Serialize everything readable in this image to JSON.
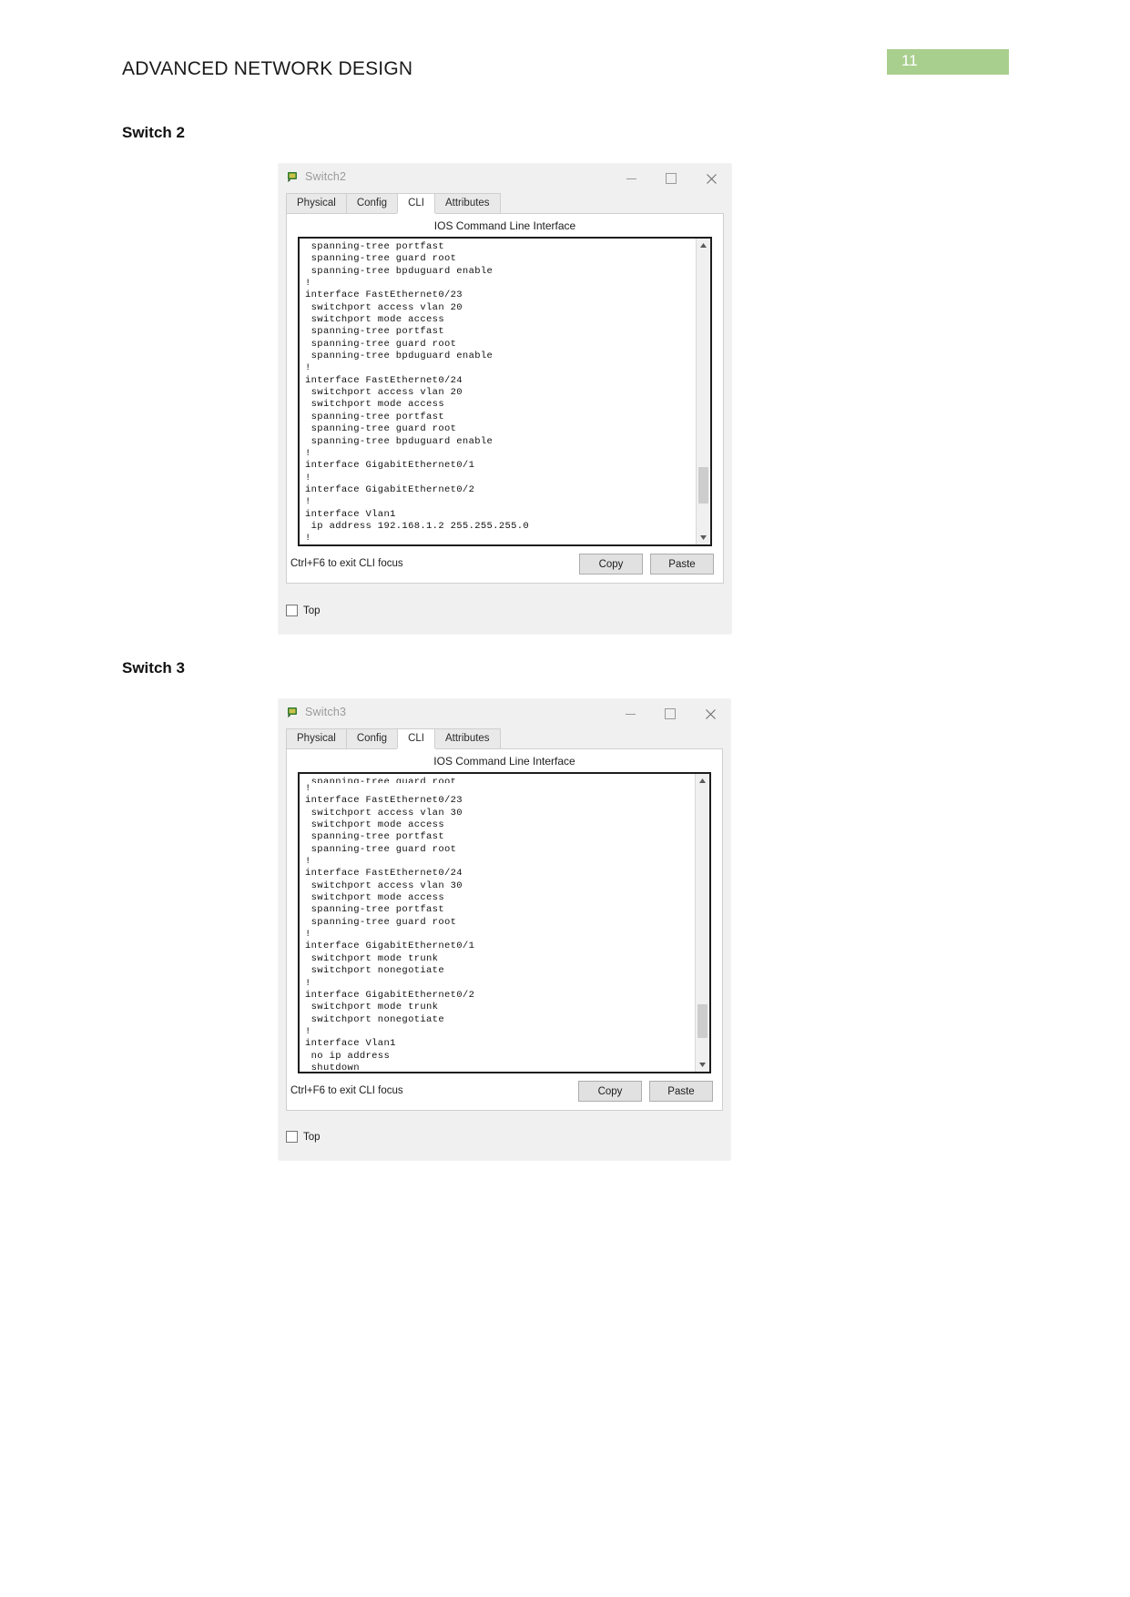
{
  "document": {
    "header_title": "ADVANCED NETWORK DESIGN",
    "page_number": "11",
    "page_number_bg": "#a9cf8f"
  },
  "sections": [
    {
      "caption": "Switch 2"
    },
    {
      "caption": "Switch 3"
    }
  ],
  "windows": [
    {
      "title": "Switch2",
      "icon": "packet-tracer-device-icon",
      "controls": {
        "minimize": "minimize-icon",
        "maximize": "maximize-icon",
        "close": "close-icon"
      },
      "tabs": [
        {
          "label": "Physical",
          "active": false
        },
        {
          "label": "Config",
          "active": false
        },
        {
          "label": "CLI",
          "active": true
        },
        {
          "label": "Attributes",
          "active": false
        }
      ],
      "cli_heading": "IOS Command Line Interface",
      "cli_lines": [
        " spanning-tree portfast",
        " spanning-tree guard root",
        " spanning-tree bpduguard enable",
        "!",
        "interface FastEthernet0/23",
        " switchport access vlan 20",
        " switchport mode access",
        " spanning-tree portfast",
        " spanning-tree guard root",
        " spanning-tree bpduguard enable",
        "!",
        "interface FastEthernet0/24",
        " switchport access vlan 20",
        " switchport mode access",
        " spanning-tree portfast",
        " spanning-tree guard root",
        " spanning-tree bpduguard enable",
        "!",
        "interface GigabitEthernet0/1",
        "!",
        "interface GigabitEthernet0/2",
        "!",
        "interface Vlan1",
        " ip address 192.168.1.2 255.255.255.0",
        "!"
      ],
      "clipped_top_line": "",
      "footer_hint": "Ctrl+F6 to exit CLI focus",
      "copy_label": "Copy",
      "paste_label": "Paste",
      "bottom_checkbox_label": "Top",
      "bottom_checkbox_checked": false,
      "scrollbar": {
        "up": "scroll-up-arrow-icon",
        "down": "scroll-down-arrow-icon",
        "thumb_top_pct": 74,
        "thumb_height_pct": 12
      }
    },
    {
      "title": "Switch3",
      "icon": "packet-tracer-device-icon",
      "controls": {
        "minimize": "minimize-icon",
        "maximize": "maximize-icon",
        "close": "close-icon"
      },
      "tabs": [
        {
          "label": "Physical",
          "active": false
        },
        {
          "label": "Config",
          "active": false
        },
        {
          "label": "CLI",
          "active": true
        },
        {
          "label": "Attributes",
          "active": false
        }
      ],
      "cli_heading": "IOS Command Line Interface",
      "clipped_top_line": " spanning-tree guard root",
      "cli_lines": [
        "!",
        "interface FastEthernet0/23",
        " switchport access vlan 30",
        " switchport mode access",
        " spanning-tree portfast",
        " spanning-tree guard root",
        "!",
        "interface FastEthernet0/24",
        " switchport access vlan 30",
        " switchport mode access",
        " spanning-tree portfast",
        " spanning-tree guard root",
        "!",
        "interface GigabitEthernet0/1",
        " switchport mode trunk",
        " switchport nonegotiate",
        "!",
        "interface GigabitEthernet0/2",
        " switchport mode trunk",
        " switchport nonegotiate",
        "!",
        "interface Vlan1",
        " no ip address",
        " shutdown"
      ],
      "footer_hint": "Ctrl+F6 to exit CLI focus",
      "copy_label": "Copy",
      "paste_label": "Paste",
      "bottom_checkbox_label": "Top",
      "bottom_checkbox_checked": false,
      "scrollbar": {
        "up": "scroll-up-arrow-icon",
        "down": "scroll-down-arrow-icon",
        "thumb_top_pct": 78,
        "thumb_height_pct": 11
      }
    }
  ]
}
